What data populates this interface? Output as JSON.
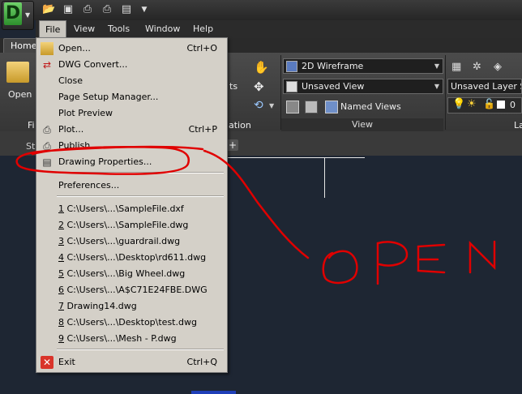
{
  "app": {
    "logo_letter": "D"
  },
  "quick_access": [
    "open-icon",
    "save-icon",
    "print-icon",
    "plot-icon",
    "properties-icon",
    "dropdown-icon"
  ],
  "menubar": {
    "items": [
      "File",
      "View",
      "Tools",
      "Window",
      "Help"
    ]
  },
  "ribbon": {
    "tab": "Home",
    "open_label": "Open",
    "partial_labels": {
      "panel_f": "Fi",
      "ts": "ts",
      "ation": "ation",
      "lay": "La"
    },
    "visual_style": "2D Wireframe",
    "saved_view": "Unsaved View",
    "named_views": "Named Views",
    "view_panel_label": "View",
    "layer_state": "Unsaved Layer Sta",
    "layer_num": "0"
  },
  "doc_tabs": {
    "partial": "St",
    "add": "+"
  },
  "file_menu": {
    "items": [
      {
        "label": "Open...",
        "shortcut": "Ctrl+O",
        "icon": "open-folder-icon"
      },
      {
        "label": "DWG Convert...",
        "shortcut": "",
        "icon": "dwg-convert-icon"
      },
      {
        "label": "Close",
        "shortcut": "",
        "icon": ""
      },
      {
        "label": "Page Setup Manager...",
        "shortcut": "",
        "icon": ""
      },
      {
        "label": "Plot Preview",
        "shortcut": "",
        "icon": ""
      },
      {
        "label": "Plot...",
        "shortcut": "Ctrl+P",
        "icon": "printer-icon"
      },
      {
        "label": "Publish...",
        "shortcut": "",
        "icon": "publish-icon"
      },
      {
        "label": "Drawing Properties...",
        "shortcut": "",
        "icon": "drawing-properties-icon"
      }
    ],
    "preferences": "Preferences...",
    "recent": [
      {
        "num": "1",
        "path": " C:\\Users\\...\\SampleFile.dxf"
      },
      {
        "num": "2",
        "path": " C:\\Users\\...\\SampleFile.dwg"
      },
      {
        "num": "3",
        "path": " C:\\Users\\...\\guardrail.dwg"
      },
      {
        "num": "4",
        "path": " C:\\Users\\...\\Desktop\\rd611.dwg"
      },
      {
        "num": "5",
        "path": " C:\\Users\\...\\Big Wheel.dwg"
      },
      {
        "num": "6",
        "path": " C:\\Users\\...\\A$C71E24FBE.DWG"
      },
      {
        "num": "7",
        "path": " Drawing14.dwg"
      },
      {
        "num": "8",
        "path": " C:\\Users\\...\\Desktop\\test.dwg"
      },
      {
        "num": "9",
        "path": " C:\\Users\\...\\Mesh - P.dwg"
      }
    ],
    "exit": {
      "label": "Exit",
      "shortcut": "Ctrl+Q"
    }
  },
  "annotation": {
    "text": "OPEN",
    "color": "#e00000"
  }
}
